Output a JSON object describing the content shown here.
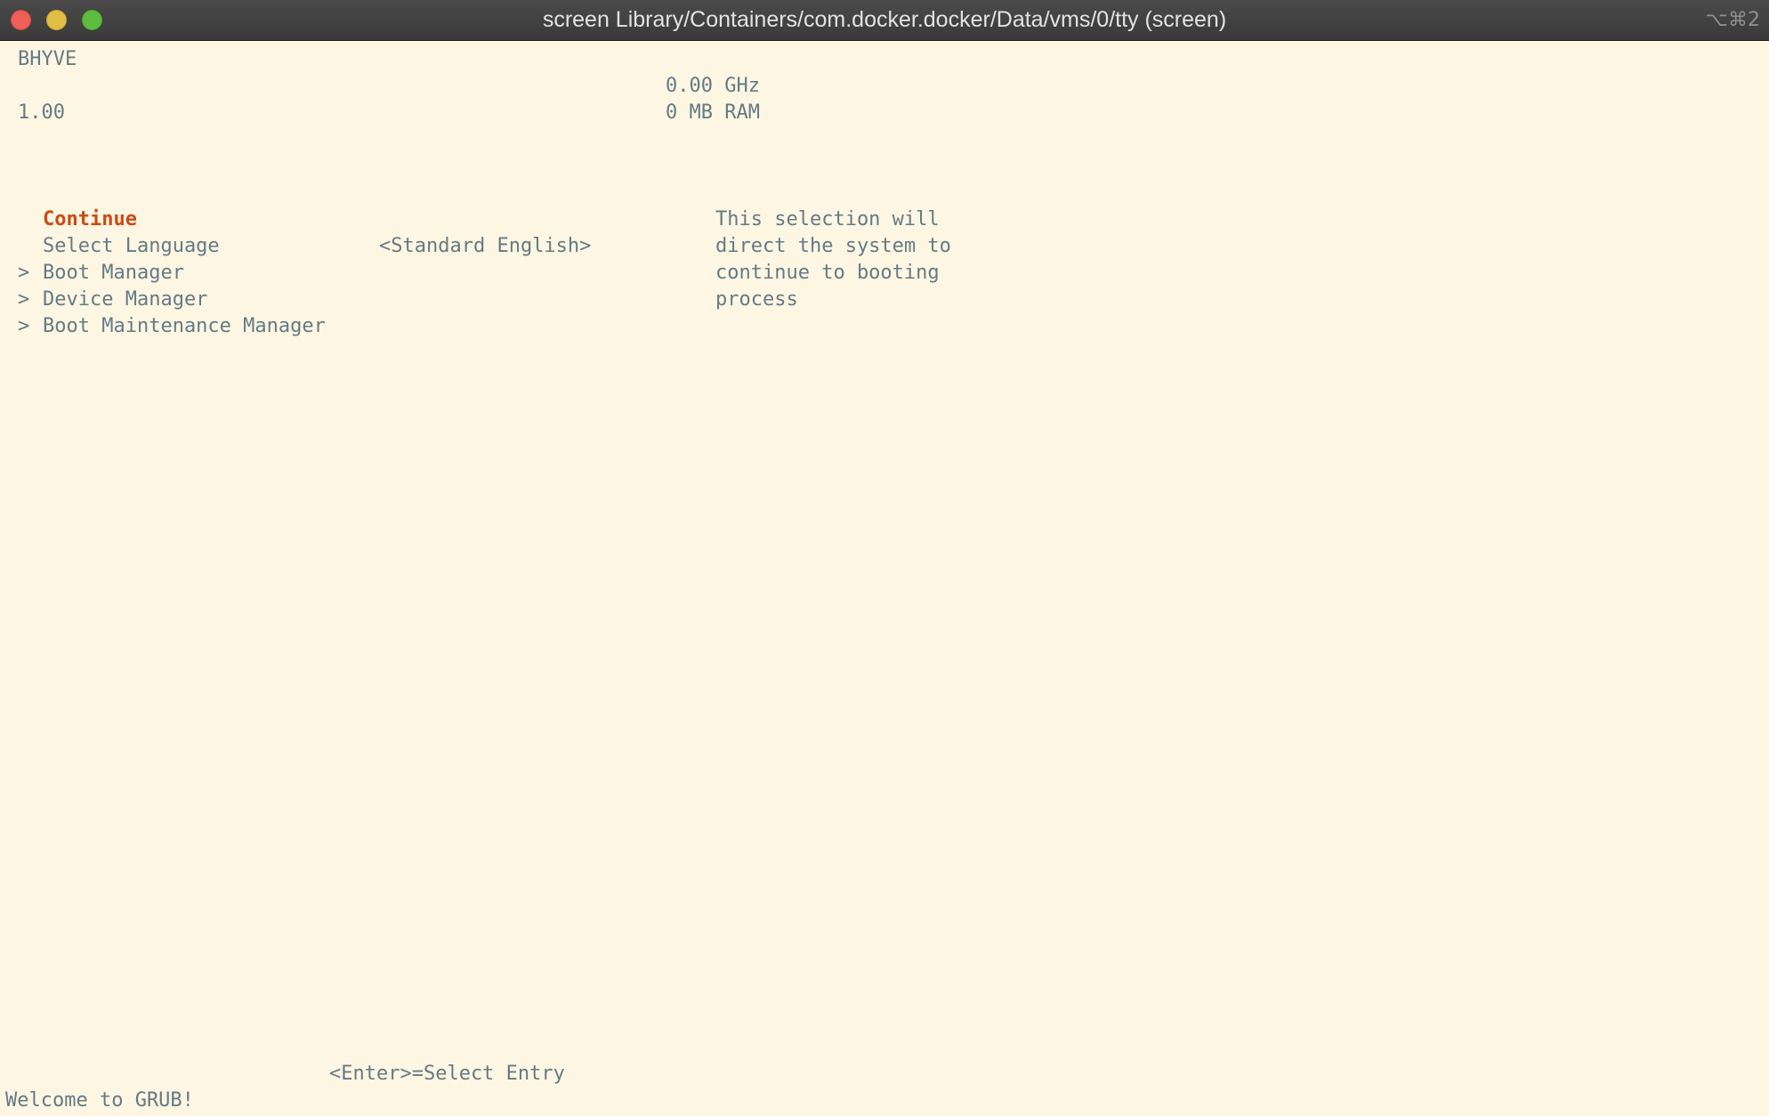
{
  "window": {
    "title": "screen Library/Containers/com.docker.docker/Data/vms/0/tty (screen)",
    "shortcut": "⌥⌘2"
  },
  "header": {
    "platform": "BHYVE",
    "version": "1.00",
    "cpu_speed": "0.00 GHz",
    "ram": "0 MB RAM"
  },
  "menu": {
    "items": [
      {
        "prefix": "",
        "label": "Continue"
      },
      {
        "prefix": "",
        "label": "Select Language"
      },
      {
        "prefix": ">",
        "label": "Boot Manager"
      },
      {
        "prefix": ">",
        "label": "Device Manager"
      },
      {
        "prefix": ">",
        "label": "Boot Maintenance Manager"
      }
    ],
    "language_value": "<Standard English>"
  },
  "help": {
    "lines": [
      "This selection will",
      "direct the system to",
      "continue to booting",
      "process"
    ]
  },
  "footer": {
    "hint": "<Enter>=Select Entry",
    "welcome": "Welcome to GRUB!"
  },
  "colors": {
    "background": "#fdf6e3",
    "text": "#657b83",
    "selected": "#cb4b16"
  }
}
